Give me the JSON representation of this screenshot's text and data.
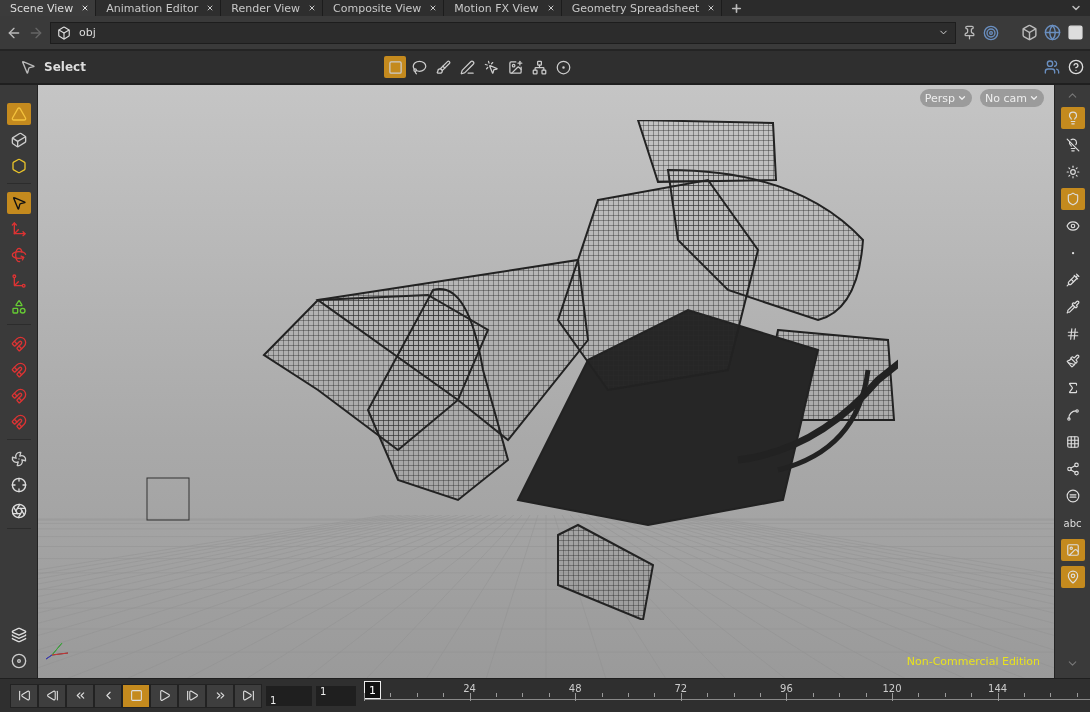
{
  "tabs": [
    {
      "label": "Scene View",
      "selected": true
    },
    {
      "label": "Animation Editor",
      "selected": false
    },
    {
      "label": "Render View",
      "selected": false
    },
    {
      "label": "Composite View",
      "selected": false
    },
    {
      "label": "Motion FX View",
      "selected": false
    },
    {
      "label": "Geometry Spreadsheet",
      "selected": false
    }
  ],
  "path": {
    "value": "obj"
  },
  "tool_options": {
    "tool": "Select",
    "selection_modes": [
      {
        "selected": true
      },
      {
        "selected": false
      },
      {
        "selected": false
      },
      {
        "selected": false
      },
      {
        "selected": false
      },
      {
        "selected": false
      },
      {
        "selected": false
      },
      {
        "selected": false
      }
    ]
  },
  "viewport": {
    "view_menu": "Persp",
    "camera_menu": "No cam",
    "edition": "Non-Commercial Edition"
  },
  "left_toolbar": {
    "groups": [
      [
        {
          "selected": true
        },
        {
          "selected": false
        },
        {
          "selected": false
        }
      ],
      [
        {
          "selected": true
        },
        {
          "selected": false
        },
        {
          "selected": false
        },
        {
          "selected": false
        },
        {
          "selected": false
        }
      ],
      [
        {
          "selected": false
        },
        {
          "selected": false
        },
        {
          "selected": false
        },
        {
          "selected": false
        }
      ],
      [
        {
          "selected": false
        },
        {
          "selected": false
        },
        {
          "selected": false
        }
      ],
      [
        {
          "selected": false
        },
        {
          "selected": false
        }
      ]
    ]
  },
  "right_toolbar": [
    {
      "kind": "icon",
      "selected": true
    },
    {
      "kind": "icon",
      "selected": false
    },
    {
      "kind": "icon",
      "selected": false
    },
    {
      "kind": "icon",
      "selected": true
    },
    {
      "kind": "icon",
      "selected": false
    },
    {
      "kind": "icon",
      "selected": false
    },
    {
      "kind": "icon",
      "selected": false
    },
    {
      "kind": "icon",
      "selected": false
    },
    {
      "kind": "icon",
      "selected": false
    },
    {
      "kind": "icon",
      "selected": false
    },
    {
      "kind": "icon",
      "selected": false
    },
    {
      "kind": "icon",
      "selected": false
    },
    {
      "kind": "icon",
      "selected": false
    },
    {
      "kind": "icon",
      "selected": false
    },
    {
      "kind": "icon",
      "selected": false
    },
    {
      "kind": "text",
      "label": "abc",
      "selected": false
    },
    {
      "kind": "icon",
      "selected": true
    },
    {
      "kind": "icon",
      "selected": true
    }
  ],
  "playbar": {
    "buttons": [
      {
        "selected": false
      },
      {
        "selected": false
      },
      {
        "selected": false
      },
      {
        "selected": false
      },
      {
        "selected": true
      },
      {
        "selected": false
      },
      {
        "selected": false
      },
      {
        "selected": false
      },
      {
        "selected": false
      }
    ],
    "frame_field": "1",
    "start_field": "1",
    "current_frame": "1",
    "ticks": [
      "24",
      "48",
      "72",
      "96",
      "120",
      "144"
    ]
  }
}
